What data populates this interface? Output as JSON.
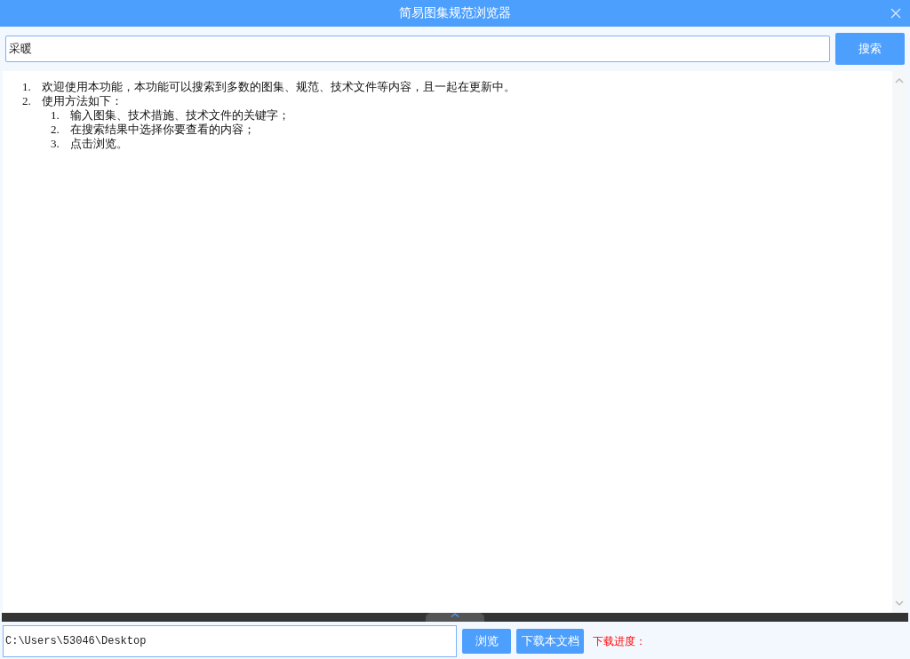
{
  "window": {
    "title": "简易图集规范浏览器"
  },
  "search": {
    "value": "采暖",
    "button": "搜索"
  },
  "instructions": [
    {
      "number": "1.",
      "text": "欢迎使用本功能，本功能可以搜索到多数的图集、规范、技术文件等内容，且一起在更新中。"
    },
    {
      "number": "2.",
      "text": "使用方法如下：",
      "children": [
        {
          "number": "1.",
          "text": "输入图集、技术措施、技术文件的关键字；"
        },
        {
          "number": "2.",
          "text": "在搜索结果中选择你要查看的内容；"
        },
        {
          "number": "3.",
          "text": "点击浏览。"
        }
      ]
    }
  ],
  "footer": {
    "path": "C:\\Users\\53046\\Desktop",
    "browse_button": "浏览",
    "download_button": "下载本文档",
    "progress_label": "下载进度："
  }
}
